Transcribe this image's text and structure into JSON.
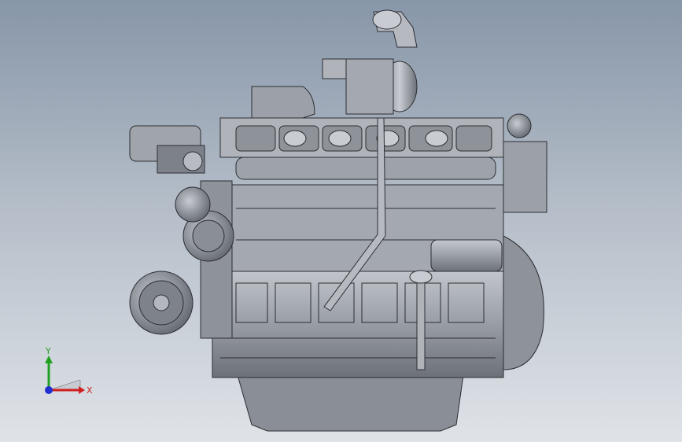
{
  "viewport": {
    "background_top": "#8796a8",
    "background_bottom": "#dfe3e8",
    "model_fill": "#9a9ea6",
    "model_stroke": "#2b2e33"
  },
  "triad": {
    "x_label": "X",
    "y_label": "Y",
    "x_color": "#d02020",
    "y_color": "#20a020",
    "z_color": "#2030d0"
  }
}
